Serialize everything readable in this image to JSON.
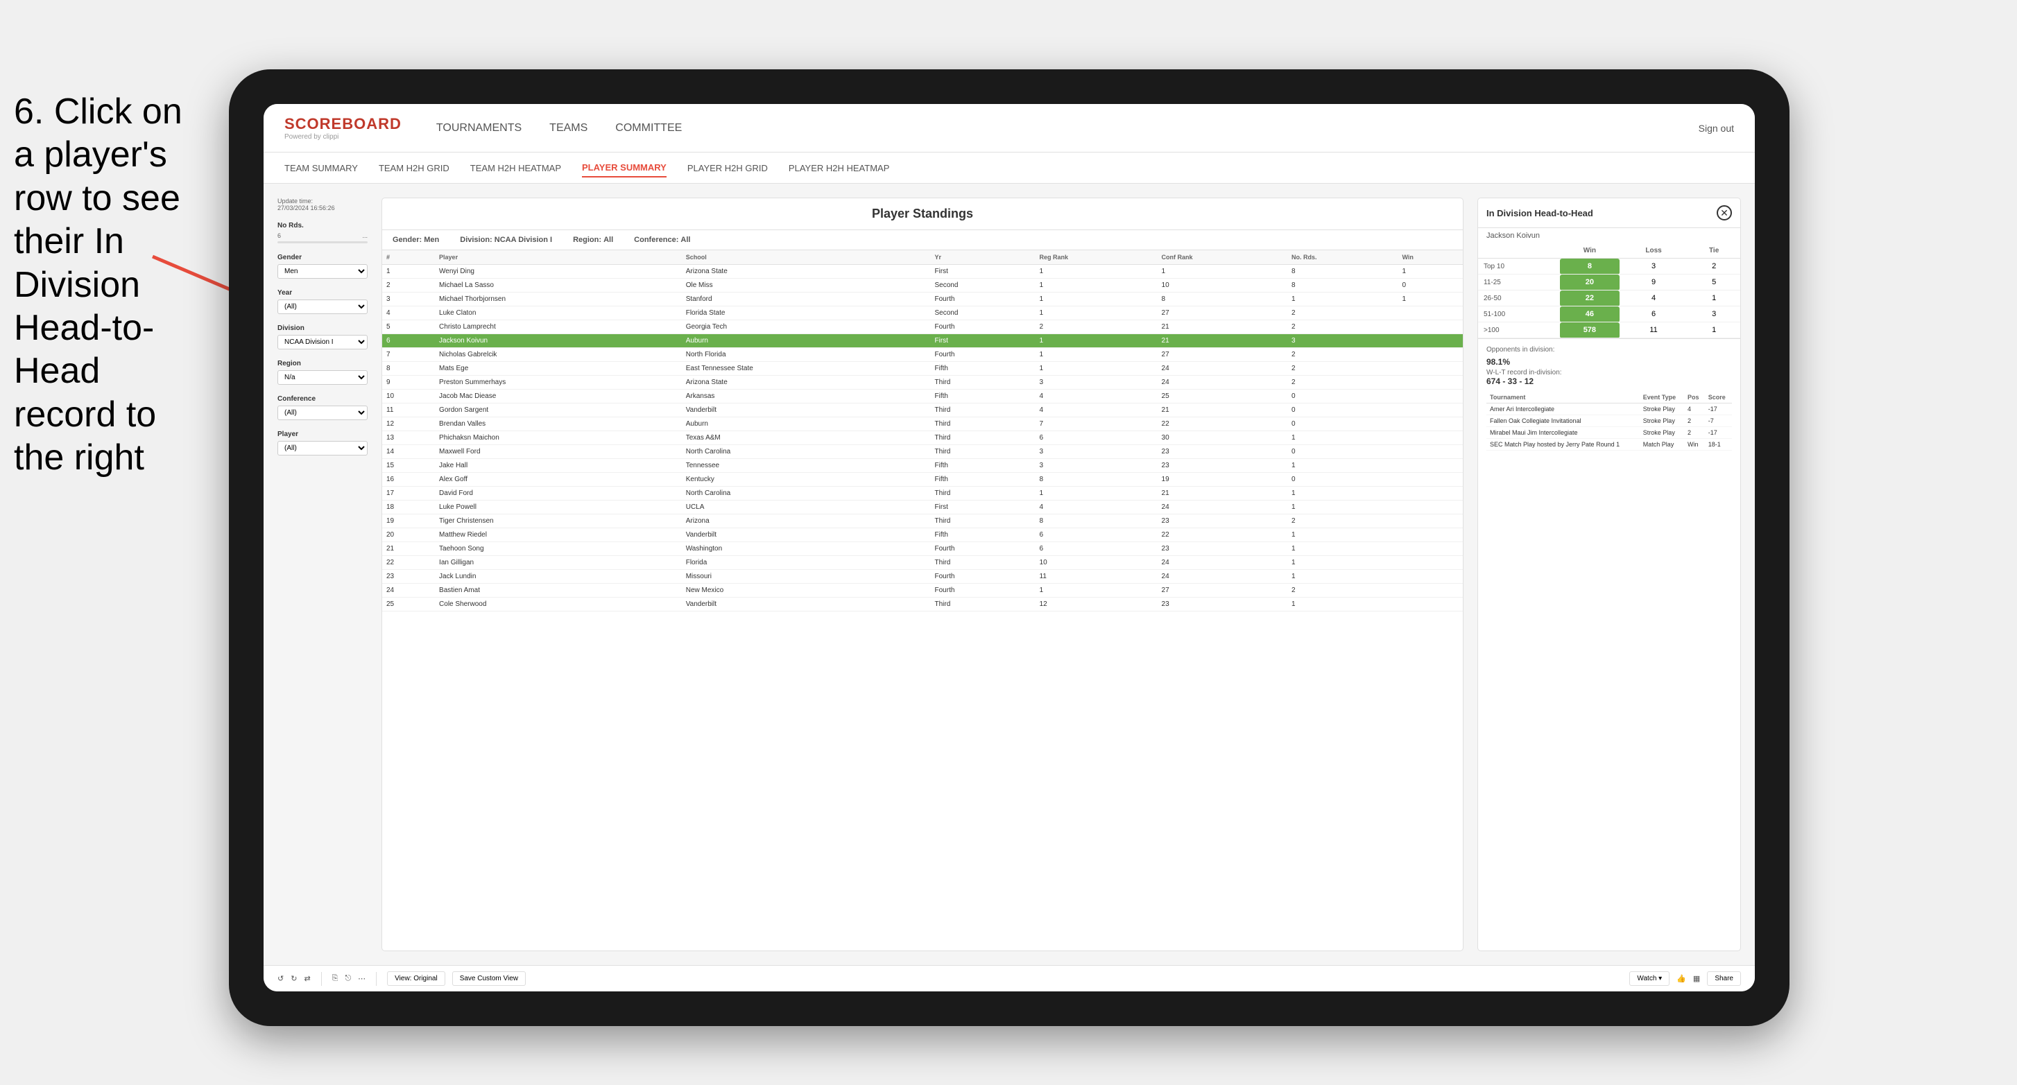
{
  "instruction": {
    "text": "6. Click on a player's row to see their In Division Head-to-Head record to the right"
  },
  "nav": {
    "logo": "SCOREBOARD",
    "logo_sub": "Powered by clippi",
    "links": [
      "TOURNAMENTS",
      "TEAMS",
      "COMMITTEE"
    ],
    "sign_out": "Sign out"
  },
  "sub_nav": {
    "links": [
      "TEAM SUMMARY",
      "TEAM H2H GRID",
      "TEAM H2H HEATMAP",
      "PLAYER SUMMARY",
      "PLAYER H2H GRID",
      "PLAYER H2H HEATMAP"
    ],
    "active": "PLAYER SUMMARY"
  },
  "sidebar": {
    "update_time_label": "Update time:",
    "update_time_value": "27/03/2024 16:56:26",
    "no_rds_label": "No Rds.",
    "range_min": "6",
    "range_max": "...",
    "gender_label": "Gender",
    "gender_value": "Men",
    "year_label": "Year",
    "year_value": "(All)",
    "division_label": "Division",
    "division_value": "NCAA Division I",
    "region_label": "Region",
    "region_value": "N/a",
    "conference_label": "Conference",
    "conference_value": "(All)",
    "player_label": "Player",
    "player_value": "(All)"
  },
  "table": {
    "title": "Player Standings",
    "gender_label": "Gender:",
    "gender_value": "Men",
    "division_label": "Division:",
    "division_value": "NCAA Division I",
    "region_label": "Region:",
    "region_value": "All",
    "conference_label": "Conference:",
    "conference_value": "All",
    "columns": [
      "#",
      "Player",
      "School",
      "Yr",
      "Reg Rank",
      "Conf Rank",
      "No. Rds.",
      "Win"
    ],
    "rows": [
      {
        "num": "1",
        "player": "Wenyi Ding",
        "school": "Arizona State",
        "yr": "First",
        "reg": "1",
        "conf": "1",
        "rds": "8",
        "win": "1"
      },
      {
        "num": "2",
        "player": "Michael La Sasso",
        "school": "Ole Miss",
        "yr": "Second",
        "reg": "1",
        "conf": "10",
        "rds": "8",
        "win": "0"
      },
      {
        "num": "3",
        "player": "Michael Thorbjornsen",
        "school": "Stanford",
        "yr": "Fourth",
        "reg": "1",
        "conf": "8",
        "rds": "1",
        "win": "1"
      },
      {
        "num": "4",
        "player": "Luke Claton",
        "school": "Florida State",
        "yr": "Second",
        "reg": "1",
        "conf": "27",
        "rds": "2",
        "win": ""
      },
      {
        "num": "5",
        "player": "Christo Lamprecht",
        "school": "Georgia Tech",
        "yr": "Fourth",
        "reg": "2",
        "conf": "21",
        "rds": "2",
        "win": ""
      },
      {
        "num": "6",
        "player": "Jackson Koivun",
        "school": "Auburn",
        "yr": "First",
        "reg": "1",
        "conf": "21",
        "rds": "3",
        "win": "",
        "highlighted": true
      },
      {
        "num": "7",
        "player": "Nicholas Gabrelcik",
        "school": "North Florida",
        "yr": "Fourth",
        "reg": "1",
        "conf": "27",
        "rds": "2",
        "win": ""
      },
      {
        "num": "8",
        "player": "Mats Ege",
        "school": "East Tennessee State",
        "yr": "Fifth",
        "reg": "1",
        "conf": "24",
        "rds": "2",
        "win": ""
      },
      {
        "num": "9",
        "player": "Preston Summerhays",
        "school": "Arizona State",
        "yr": "Third",
        "reg": "3",
        "conf": "24",
        "rds": "2",
        "win": ""
      },
      {
        "num": "10",
        "player": "Jacob Mac Diease",
        "school": "Arkansas",
        "yr": "Fifth",
        "reg": "4",
        "conf": "25",
        "rds": "0",
        "win": ""
      },
      {
        "num": "11",
        "player": "Gordon Sargent",
        "school": "Vanderbilt",
        "yr": "Third",
        "reg": "4",
        "conf": "21",
        "rds": "0",
        "win": ""
      },
      {
        "num": "12",
        "player": "Brendan Valles",
        "school": "Auburn",
        "yr": "Third",
        "reg": "7",
        "conf": "22",
        "rds": "0",
        "win": ""
      },
      {
        "num": "13",
        "player": "Phichaksn Maichon",
        "school": "Texas A&M",
        "yr": "Third",
        "reg": "6",
        "conf": "30",
        "rds": "1",
        "win": ""
      },
      {
        "num": "14",
        "player": "Maxwell Ford",
        "school": "North Carolina",
        "yr": "Third",
        "reg": "3",
        "conf": "23",
        "rds": "0",
        "win": ""
      },
      {
        "num": "15",
        "player": "Jake Hall",
        "school": "Tennessee",
        "yr": "Fifth",
        "reg": "3",
        "conf": "23",
        "rds": "1",
        "win": ""
      },
      {
        "num": "16",
        "player": "Alex Goff",
        "school": "Kentucky",
        "yr": "Fifth",
        "reg": "8",
        "conf": "19",
        "rds": "0",
        "win": ""
      },
      {
        "num": "17",
        "player": "David Ford",
        "school": "North Carolina",
        "yr": "Third",
        "reg": "1",
        "conf": "21",
        "rds": "1",
        "win": ""
      },
      {
        "num": "18",
        "player": "Luke Powell",
        "school": "UCLA",
        "yr": "First",
        "reg": "4",
        "conf": "24",
        "rds": "1",
        "win": ""
      },
      {
        "num": "19",
        "player": "Tiger Christensen",
        "school": "Arizona",
        "yr": "Third",
        "reg": "8",
        "conf": "23",
        "rds": "2",
        "win": ""
      },
      {
        "num": "20",
        "player": "Matthew Riedel",
        "school": "Vanderbilt",
        "yr": "Fifth",
        "reg": "6",
        "conf": "22",
        "rds": "1",
        "win": ""
      },
      {
        "num": "21",
        "player": "Taehoon Song",
        "school": "Washington",
        "yr": "Fourth",
        "reg": "6",
        "conf": "23",
        "rds": "1",
        "win": ""
      },
      {
        "num": "22",
        "player": "Ian Gilligan",
        "school": "Florida",
        "yr": "Third",
        "reg": "10",
        "conf": "24",
        "rds": "1",
        "win": ""
      },
      {
        "num": "23",
        "player": "Jack Lundin",
        "school": "Missouri",
        "yr": "Fourth",
        "reg": "11",
        "conf": "24",
        "rds": "1",
        "win": ""
      },
      {
        "num": "24",
        "player": "Bastien Amat",
        "school": "New Mexico",
        "yr": "Fourth",
        "reg": "1",
        "conf": "27",
        "rds": "2",
        "win": ""
      },
      {
        "num": "25",
        "player": "Cole Sherwood",
        "school": "Vanderbilt",
        "yr": "Third",
        "reg": "12",
        "conf": "23",
        "rds": "1",
        "win": ""
      }
    ]
  },
  "h2h": {
    "title": "In Division Head-to-Head",
    "player_name": "Jackson Koivun",
    "col_win": "Win",
    "col_loss": "Loss",
    "col_tie": "Tie",
    "ranges": [
      {
        "label": "Top 10",
        "win": "8",
        "loss": "3",
        "tie": "2"
      },
      {
        "label": "11-25",
        "win": "20",
        "loss": "9",
        "tie": "5"
      },
      {
        "label": "26-50",
        "win": "22",
        "loss": "4",
        "tie": "1"
      },
      {
        "label": "51-100",
        "win": "46",
        "loss": "6",
        "tie": "3"
      },
      {
        "label": ">100",
        "win": "578",
        "loss": "11",
        "tie": "1"
      }
    ],
    "opponents_label": "Opponents in division:",
    "percentage": "98.1%",
    "wl_label": "W-L-T record in-division:",
    "record": "674 - 33 - 12",
    "tournament_cols": [
      "Tournament",
      "Event Type",
      "Pos",
      "Score"
    ],
    "tournaments": [
      {
        "name": "Amer Ari Intercollegiate",
        "type": "Stroke Play",
        "pos": "4",
        "score": "-17"
      },
      {
        "name": "Fallen Oak Collegiate Invitational",
        "type": "Stroke Play",
        "pos": "2",
        "score": "-7"
      },
      {
        "name": "Mirabel Maui Jim Intercollegiate",
        "type": "Stroke Play",
        "pos": "2",
        "score": "-17"
      },
      {
        "name": "SEC Match Play hosted by Jerry Pate Round 1",
        "type": "Match Play",
        "pos": "Win",
        "score": "18-1"
      }
    ]
  },
  "toolbar": {
    "view_original": "View: Original",
    "save_custom": "Save Custom View",
    "watch": "Watch ▾",
    "share": "Share"
  }
}
